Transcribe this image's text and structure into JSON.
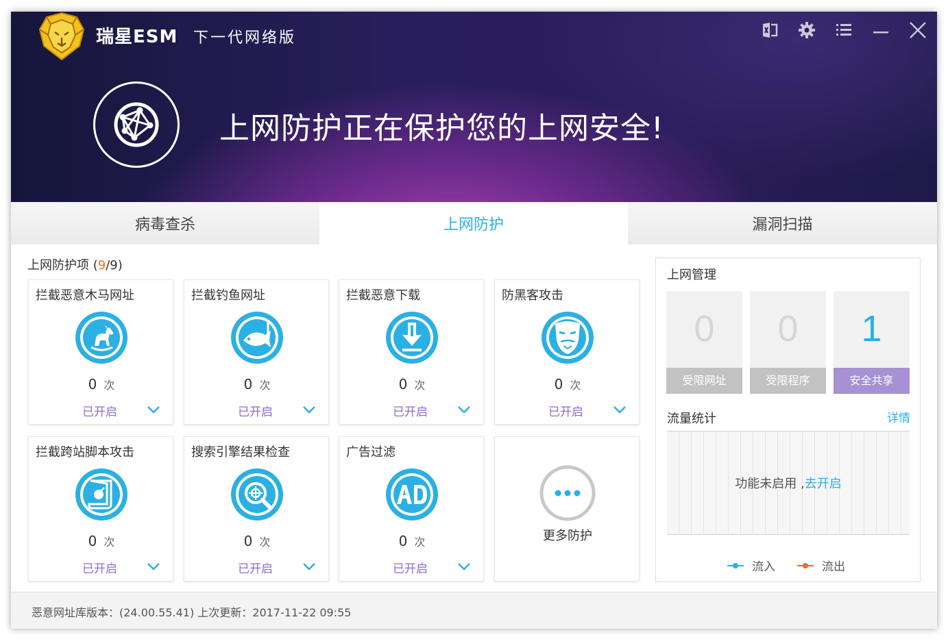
{
  "app": {
    "title": "瑞星ESM",
    "subtitle": "下一代网络版"
  },
  "window_controls": [
    "feedback-icon",
    "gear-icon",
    "menu-icon",
    "minimize-icon",
    "close-icon"
  ],
  "hero": {
    "message": "上网防护正在保护您的上网安全!"
  },
  "tabs": [
    {
      "label": "病毒查杀",
      "active": false
    },
    {
      "label": "上网防护",
      "active": true
    },
    {
      "label": "漏洞扫描",
      "active": false
    }
  ],
  "protection": {
    "title": "上网防护项",
    "count_open": "(",
    "count_active": "9",
    "count_rest": "/9)",
    "items": [
      {
        "title": "拦截恶意木马网址",
        "count": "0",
        "unit": "次",
        "status": "已开启",
        "icon": "horse-icon"
      },
      {
        "title": "拦截钓鱼网址",
        "count": "0",
        "unit": "次",
        "status": "已开启",
        "icon": "fish-hook-icon"
      },
      {
        "title": "拦截恶意下载",
        "count": "0",
        "unit": "次",
        "status": "已开启",
        "icon": "download-icon"
      },
      {
        "title": "防黑客攻击",
        "count": "0",
        "unit": "次",
        "status": "已开启",
        "icon": "hacker-mask-icon"
      },
      {
        "title": "拦截跨站脚本攻击",
        "count": "0",
        "unit": "次",
        "status": "已开启",
        "icon": "script-bomb-icon"
      },
      {
        "title": "搜索引擎结果检查",
        "count": "0",
        "unit": "次",
        "status": "已开启",
        "icon": "search-target-icon"
      },
      {
        "title": "广告过滤",
        "count": "0",
        "unit": "次",
        "status": "已开启",
        "icon": "ad-icon"
      }
    ],
    "more_label": "更多防护"
  },
  "management": {
    "title": "上网管理",
    "stats": [
      {
        "value": "0",
        "label": "受限网址"
      },
      {
        "value": "0",
        "label": "受限程序"
      },
      {
        "value": "1",
        "label": "安全共享"
      }
    ]
  },
  "traffic": {
    "title": "流量统计",
    "detail_link": "详情",
    "message": "功能未启用 ,",
    "enable_link": "去开启",
    "legend_in": "流入",
    "legend_out": "流出",
    "color_in": "#2bb0e4",
    "color_out": "#f26b21"
  },
  "footer": {
    "text": "恶意网址库版本：(24.00.55.41)   上次更新：2017-11-22 09:55"
  }
}
